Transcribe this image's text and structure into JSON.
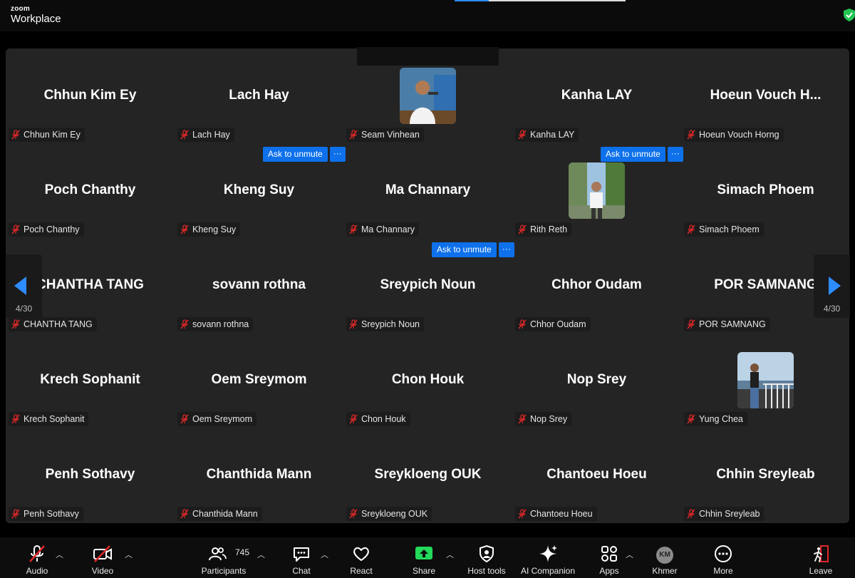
{
  "app": {
    "logo_top": "zoom",
    "logo_bottom": "Workplace"
  },
  "grid": {
    "tiles": [
      {
        "big": "Chhun Kim Ey",
        "tag": "Chhun Kim Ey"
      },
      {
        "big": "Lach Hay",
        "tag": "Lach Hay"
      },
      {
        "big": "",
        "tag": "Seam Vinhean",
        "avatar": "presenter-photo"
      },
      {
        "big": "Kanha LAY",
        "tag": "Kanha LAY"
      },
      {
        "big": "Hoeun Vouch H...",
        "tag": "Hoeun Vouch Horng"
      },
      {
        "big": "Poch Chanthy",
        "tag": "Poch Chanthy"
      },
      {
        "big": "Kheng Suy",
        "tag": "Kheng Suy"
      },
      {
        "big": "Ma Channary",
        "tag": "Ma Channary"
      },
      {
        "big": "",
        "tag": "Rith Reth",
        "avatar": "outdoor-photo"
      },
      {
        "big": "Simach Phoem",
        "tag": "Simach Phoem"
      },
      {
        "big": "CHANTHA TANG",
        "tag": "CHANTHA TANG"
      },
      {
        "big": "sovann rothna",
        "tag": "sovann rothna"
      },
      {
        "big": "Sreypich Noun",
        "tag": "Sreypich Noun"
      },
      {
        "big": "Chhor Oudam",
        "tag": "Chhor Oudam"
      },
      {
        "big": "POR SAMNANG",
        "tag": "POR SAMNANG"
      },
      {
        "big": "Krech Sophanit",
        "tag": "Krech Sophanit"
      },
      {
        "big": "Oem Sreymom",
        "tag": "Oem Sreymom"
      },
      {
        "big": "Chon Houk",
        "tag": "Chon Houk"
      },
      {
        "big": "Nop Srey",
        "tag": "Nop Srey"
      },
      {
        "big": "",
        "tag": "Yung Chea",
        "avatar": "balcony-photo"
      },
      {
        "big": "Penh Sothavy",
        "tag": "Penh Sothavy"
      },
      {
        "big": "Chanthida Mann",
        "tag": "Chanthida Mann"
      },
      {
        "big": "Sreykloeng OUK",
        "tag": "Sreykloeng OUK"
      },
      {
        "big": "Chantoeu Hoeu",
        "tag": "Chantoeu Hoeu"
      },
      {
        "big": "Chhin Sreyleab",
        "tag": "Chhin Sreyleab"
      }
    ],
    "ask_to_unmute": "Ask to unmute",
    "more_dots": "···"
  },
  "pager": {
    "left": "4/30",
    "right": "4/30"
  },
  "toolbar": {
    "audio": "Audio",
    "video": "Video",
    "participants": "Participants",
    "participants_count": "745",
    "chat": "Chat",
    "react": "React",
    "share": "Share",
    "host_tools": "Host tools",
    "ai_companion": "AI Companion",
    "apps": "Apps",
    "language": "Khmer",
    "language_initials": "KM",
    "more": "More",
    "leave": "Leave"
  },
  "colors": {
    "accent": "#0e71eb",
    "share_green": "#23d959",
    "muted_red": "#e02828",
    "panel": "#242424"
  }
}
